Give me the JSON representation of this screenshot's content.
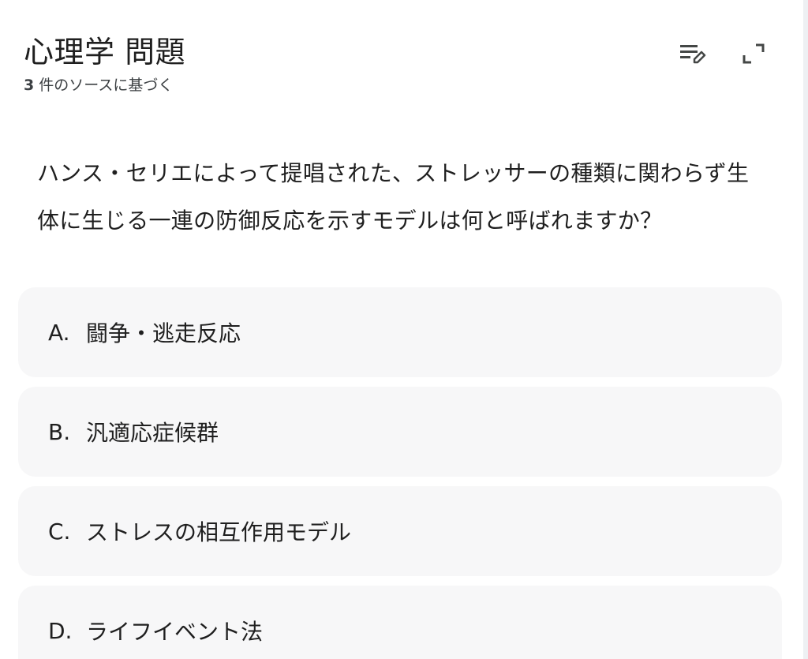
{
  "header": {
    "title": "心理学 問題",
    "source_count": "3",
    "source_text": " 件のソースに基づく"
  },
  "toolbar": {
    "edit_icon": "list-edit-icon",
    "expand_icon": "expand-icon"
  },
  "question": {
    "text": "ハンス・セリエによって提唱された、ストレッサーの種類に関わらず生体に生じる一連の防御反応を示すモデルは何と呼ばれますか？"
  },
  "options": [
    {
      "letter": "A.",
      "label": "闘争・逃走反応"
    },
    {
      "letter": "B.",
      "label": "汎適応症候群"
    },
    {
      "letter": "C.",
      "label": "ストレスの相互作用モデル"
    },
    {
      "letter": "D.",
      "label": "ライフイベント法"
    }
  ],
  "colors": {
    "option_bg": "#f7f7f8",
    "text": "#1f1f1f",
    "subtext": "#3c4043"
  }
}
